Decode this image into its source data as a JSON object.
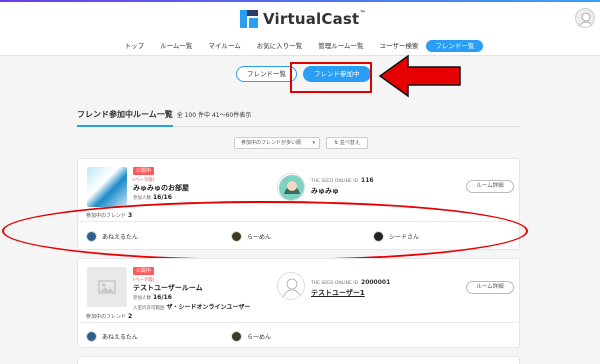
{
  "header": {
    "logo_text": "VirtualCast",
    "logo_tm": "™"
  },
  "nav": {
    "items": [
      {
        "label": "トップ",
        "active": false
      },
      {
        "label": "ルーム一覧",
        "active": false
      },
      {
        "label": "マイルーム",
        "active": false
      },
      {
        "label": "お気に入り一覧",
        "active": false
      },
      {
        "label": "管理ルーム一覧",
        "active": false
      },
      {
        "label": "ユーザー検索",
        "active": false
      },
      {
        "label": "フレンド一覧",
        "active": true
      }
    ]
  },
  "subtabs": {
    "friend_list": "フレンド一覧",
    "friend_joined": "フレンド参加中"
  },
  "section": {
    "title": "フレンド参加中ルーム一覧",
    "count_text": "全 100 件中 41〜60件表示"
  },
  "controls": {
    "sort_select_value": "参加中のフレンドが多い順",
    "sort_button": "並べ替え"
  },
  "cards": [
    {
      "badge": "公開中",
      "beta": "(ベータ版)",
      "room_name": "みゅみゅのお部屋",
      "capacity_label": "参加人数",
      "capacity_value": "16/16",
      "owner_id_label": "THE SEED ONLINE ID",
      "owner_id": "116",
      "owner_name": "みゅみゅ",
      "detail_button": "ルーム詳細",
      "friends_label": "参加中のフレンド",
      "friends_count": "3",
      "friends": [
        "あねえるたん",
        "らーめん",
        "シードさん"
      ]
    },
    {
      "badge": "公開中",
      "beta": "(ベータ版)",
      "room_name": "テストユーザールーム",
      "capacity_label": "参加人数",
      "capacity_value": "16/16",
      "permission_label": "入室の許可範囲",
      "permission_value": "ザ・シードオンラインユーザー",
      "owner_id_label": "THE SEED ONLINE ID",
      "owner_id": "2000001",
      "owner_name": "テストユーザー1",
      "detail_button": "ルーム詳細",
      "friends_label": "参加中のフレンド",
      "friends_count": "2",
      "friends": [
        "あねえるたん",
        "らーめん"
      ]
    }
  ],
  "colors": {
    "accent": "#2a9df4",
    "badge": "#ff5a5a",
    "annotation": "#e60000"
  }
}
